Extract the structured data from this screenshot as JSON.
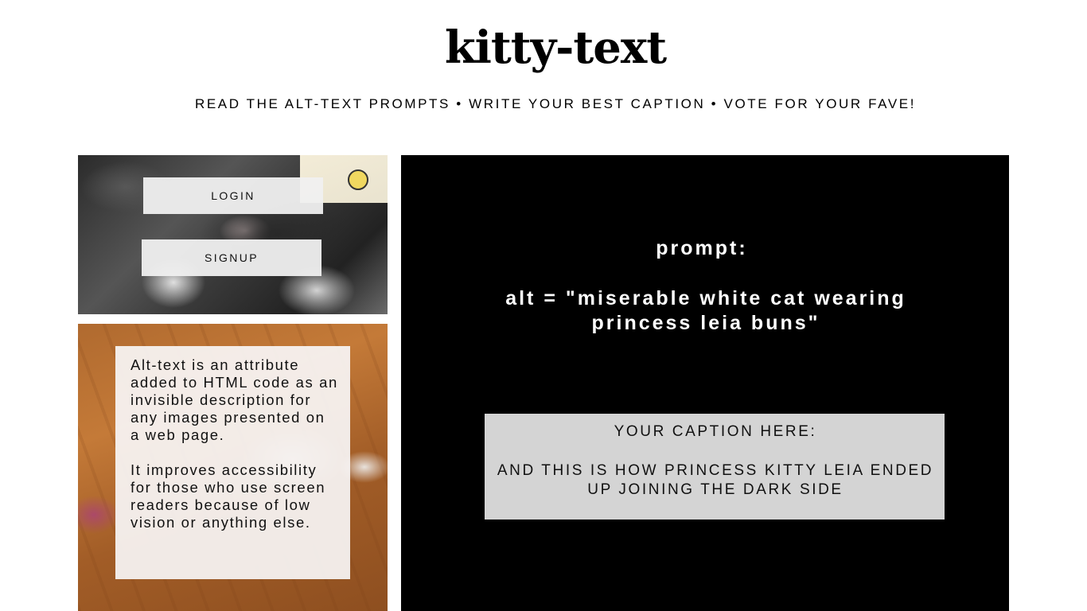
{
  "header": {
    "title": "kitty-text",
    "tagline": "READ THE ALT-TEXT PROMPTS • WRITE YOUR BEST CAPTION • VOTE FOR YOUR FAVE!"
  },
  "auth": {
    "login_label": "LOGIN",
    "signup_label": "SIGNUP"
  },
  "info": {
    "paragraph1": "Alt-text is an attribute added to HTML code as an invisible description for any images presented on a web page.",
    "paragraph2": "It improves accessibility for those who use screen readers because of low vision or anything else."
  },
  "prompt": {
    "label": "prompt:",
    "text": "alt = \"miserable white cat wearing princess leia buns\""
  },
  "caption": {
    "label": "YOUR CAPTION HERE:",
    "text": "AND THIS IS HOW PRINCESS KITTY LEIA ENDED UP JOINING THE DARK SIDE"
  },
  "colors": {
    "prompt_panel_bg": "#000000",
    "caption_box_bg": "#d4d4d4",
    "button_bg": "#f0f0f0"
  }
}
